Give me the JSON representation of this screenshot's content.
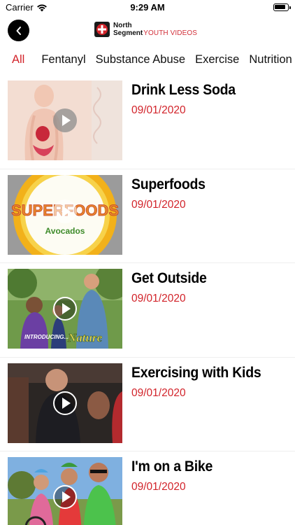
{
  "status_bar": {
    "carrier": "Carrier",
    "time": "9:29 AM"
  },
  "header": {
    "back_icon": "chevron-left-icon",
    "logo_line1": "North",
    "logo_line2": "Segment",
    "logo_line2b": "YOUTH VIDEOS"
  },
  "colors": {
    "accent": "#d2232a",
    "background": "#ffffff"
  },
  "tabs": [
    {
      "label": "All",
      "active": true
    },
    {
      "label": "Fentanyl",
      "active": false
    },
    {
      "label": "Substance Abuse",
      "active": false
    },
    {
      "label": "Exercise",
      "active": false
    },
    {
      "label": "Nutrition",
      "active": false
    }
  ],
  "videos": [
    {
      "title": "Drink Less Soda",
      "date": "09/01/2020"
    },
    {
      "title": "Superfoods",
      "date": "09/01/2020",
      "thumb_caption": "Avocados"
    },
    {
      "title": "Get Outside",
      "date": "09/01/2020",
      "thumb_caption": "INTRODUCING...",
      "thumb_caption2": "Nature"
    },
    {
      "title": "Exercising with Kids",
      "date": "09/01/2020"
    },
    {
      "title": "I'm on a Bike",
      "date": "09/01/2020"
    }
  ]
}
